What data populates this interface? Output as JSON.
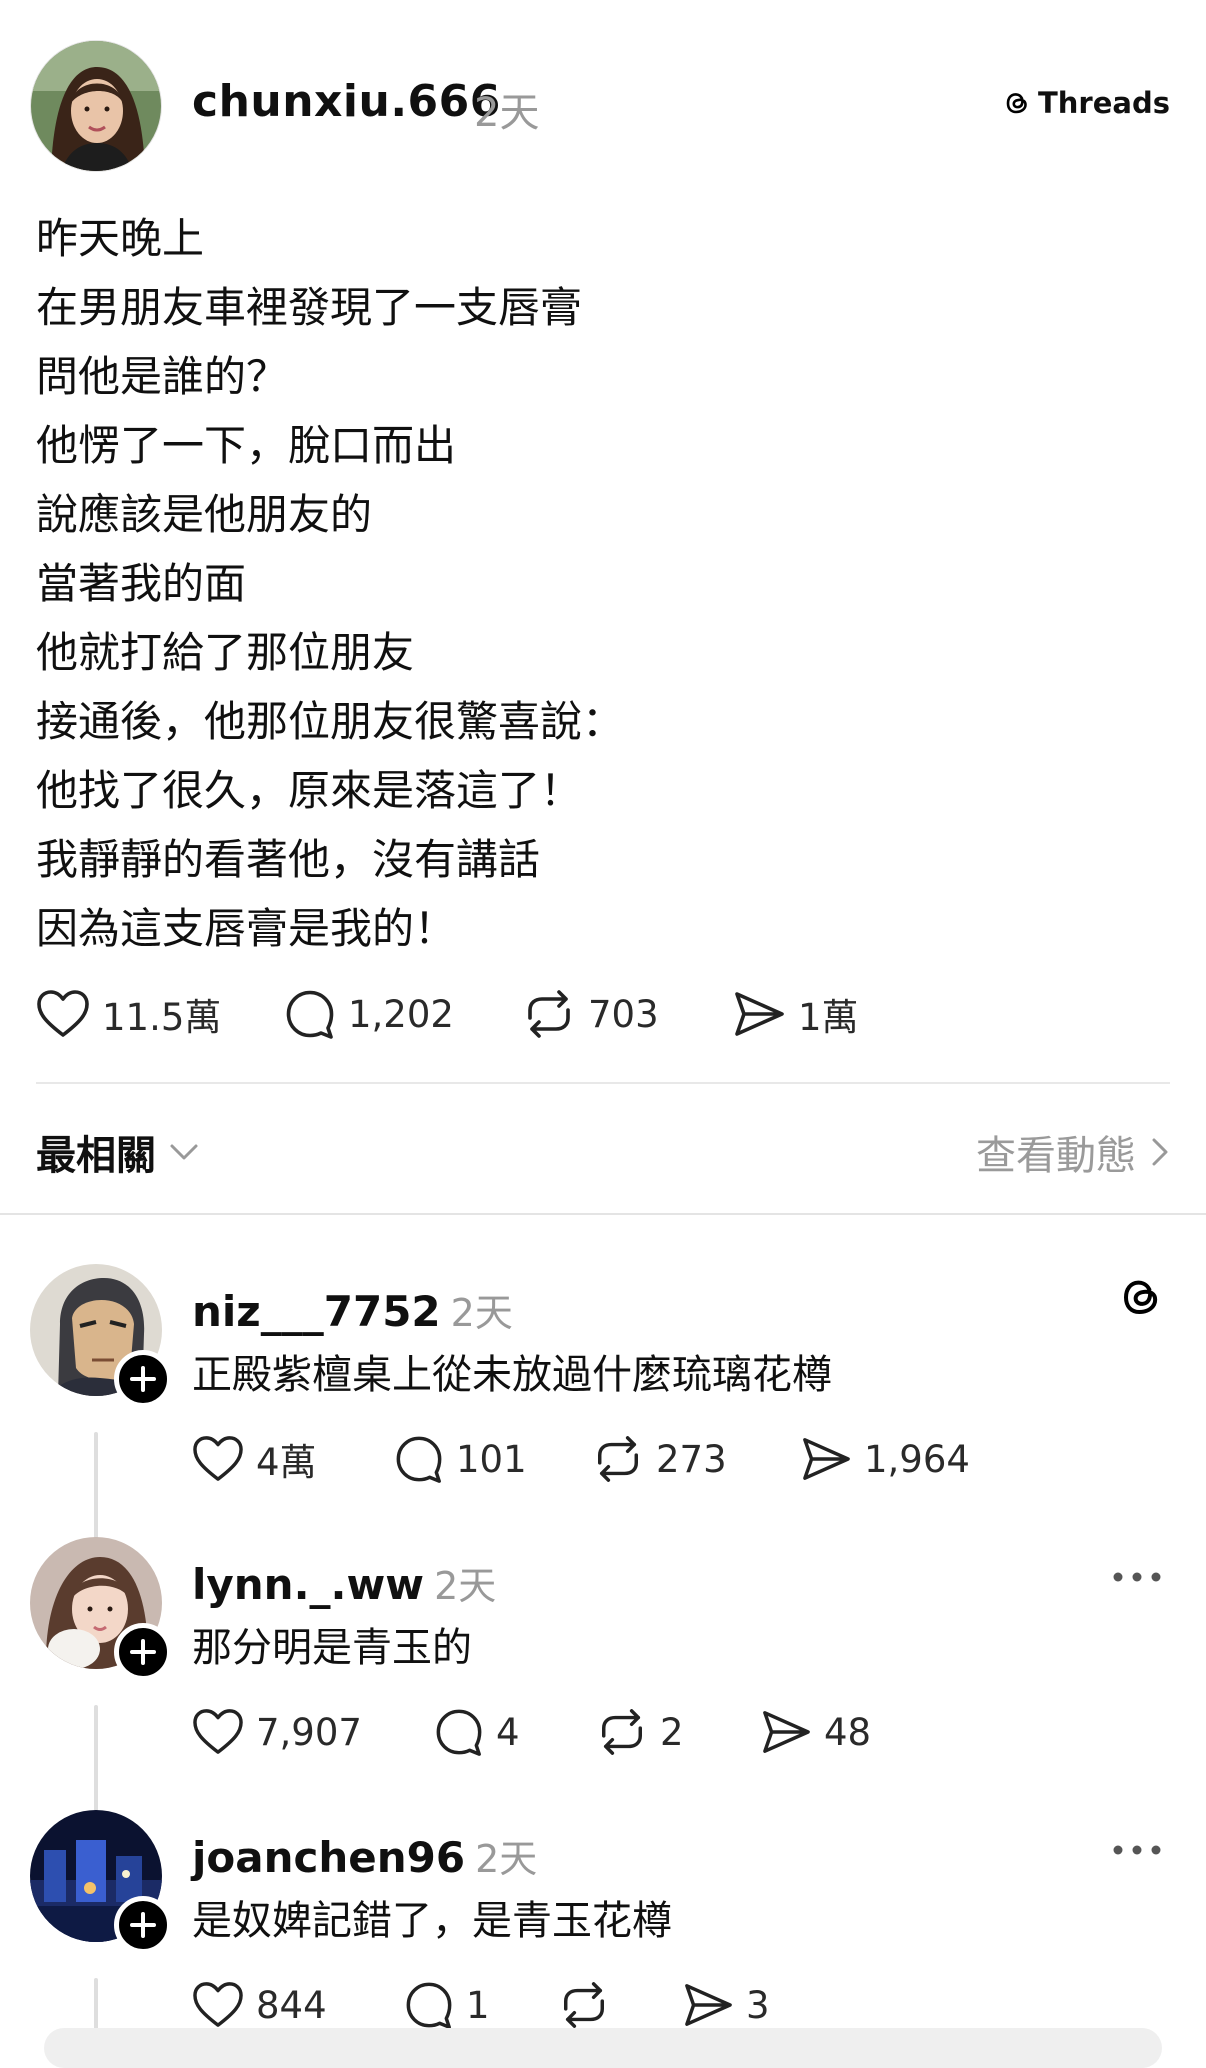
{
  "post": {
    "username": "chunxiu.666",
    "time": "2天",
    "source_label": "Threads",
    "lines": [
      "昨天晚上",
      "在男朋友車裡發現了一支唇膏",
      "問他是誰的？",
      "他愣了一下，脫口而出",
      "說應該是他朋友的",
      "當著我的面",
      "他就打給了那位朋友",
      "接通後，他那位朋友很驚喜說：",
      "他找了很久，原來是落這了！",
      "我靜靜的看著他，沒有講話",
      "因為這支唇膏是我的！"
    ],
    "likes": "11.5萬",
    "comments": "1,202",
    "reposts": "703",
    "shares": "1萬"
  },
  "sort": {
    "label": "最相關",
    "activity_link": "查看動態"
  },
  "replies": [
    {
      "username": "niz___7752",
      "time": "2天",
      "text": "正殿紫檀桌上從未放過什麼琉璃花樽",
      "likes": "4萬",
      "comments": "101",
      "reposts": "273",
      "shares": "1,964",
      "menu_icon": "threads-icon"
    },
    {
      "username": "lynn._.ww",
      "time": "2天",
      "text": "那分明是青玉的",
      "likes": "7,907",
      "comments": "4",
      "reposts": "2",
      "shares": "48",
      "menu_icon": "more-icon"
    },
    {
      "username": "joanchen96",
      "time": "2天",
      "text": "是奴婢記錯了，是青玉花樽",
      "likes": "844",
      "comments": "1",
      "reposts": "",
      "shares": "3",
      "menu_icon": "more-icon"
    }
  ]
}
